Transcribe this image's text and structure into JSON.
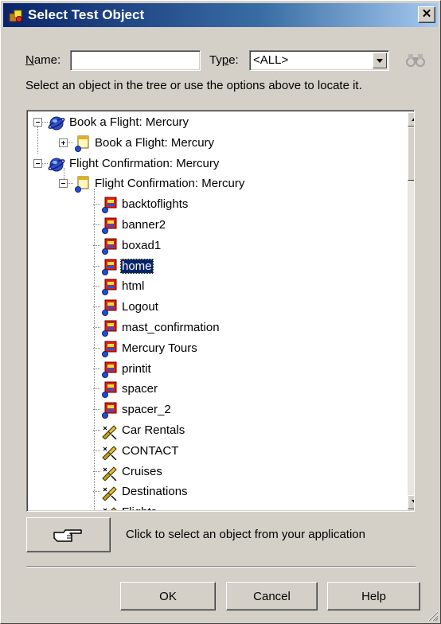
{
  "window": {
    "title": "Select Test Object",
    "close_symbol": "✕"
  },
  "filters": {
    "name_label_mnemonic": "N",
    "name_label_rest": "ame:",
    "name_value": "",
    "type_label_pre": "Ty",
    "type_label_mnemonic": "p",
    "type_label_post": "e:",
    "type_value": "<ALL>"
  },
  "instructions": "Select an object in the tree or use the options above to locate it.",
  "tree": {
    "items": [
      {
        "label": "Book a Flight: Mercury",
        "icon": "browser-icon",
        "level": 0,
        "expander": "minus"
      },
      {
        "label": "Book a Flight: Mercury",
        "icon": "page-icon",
        "level": 1,
        "expander": "plus"
      },
      {
        "label": "Flight Confirmation: Mercury",
        "icon": "browser-icon",
        "level": 0,
        "expander": "minus"
      },
      {
        "label": "Flight Confirmation: Mercury",
        "icon": "page-icon",
        "level": 1,
        "expander": "minus"
      },
      {
        "label": "backtoflights",
        "icon": "image-icon",
        "level": 2
      },
      {
        "label": "banner2",
        "icon": "image-icon",
        "level": 2
      },
      {
        "label": "boxad1",
        "icon": "image-icon",
        "level": 2
      },
      {
        "label": "home",
        "icon": "image-icon",
        "level": 2,
        "selected": true
      },
      {
        "label": "html",
        "icon": "image-icon",
        "level": 2
      },
      {
        "label": "Logout",
        "icon": "image-icon",
        "level": 2
      },
      {
        "label": "mast_confirmation",
        "icon": "image-icon",
        "level": 2
      },
      {
        "label": "Mercury Tours",
        "icon": "image-icon",
        "level": 2
      },
      {
        "label": "printit",
        "icon": "image-icon",
        "level": 2
      },
      {
        "label": "spacer",
        "icon": "image-icon",
        "level": 2
      },
      {
        "label": "spacer_2",
        "icon": "image-icon",
        "level": 2
      },
      {
        "label": "Car Rentals",
        "icon": "link-icon",
        "level": 2
      },
      {
        "label": "CONTACT",
        "icon": "link-icon",
        "level": 2
      },
      {
        "label": "Cruises",
        "icon": "link-icon",
        "level": 2
      },
      {
        "label": "Destinations",
        "icon": "link-icon",
        "level": 2
      },
      {
        "label": "Flights",
        "icon": "link-icon",
        "level": 2
      }
    ]
  },
  "pointer": {
    "label": "Click to select an object from your application"
  },
  "buttons": {
    "ok": "OK",
    "cancel": "Cancel",
    "help": "Help"
  },
  "colors": {
    "dialog_bg": "#d4d0c8",
    "title_start": "#0a246a",
    "title_end": "#a6caf0",
    "selection": "#0a246a"
  }
}
